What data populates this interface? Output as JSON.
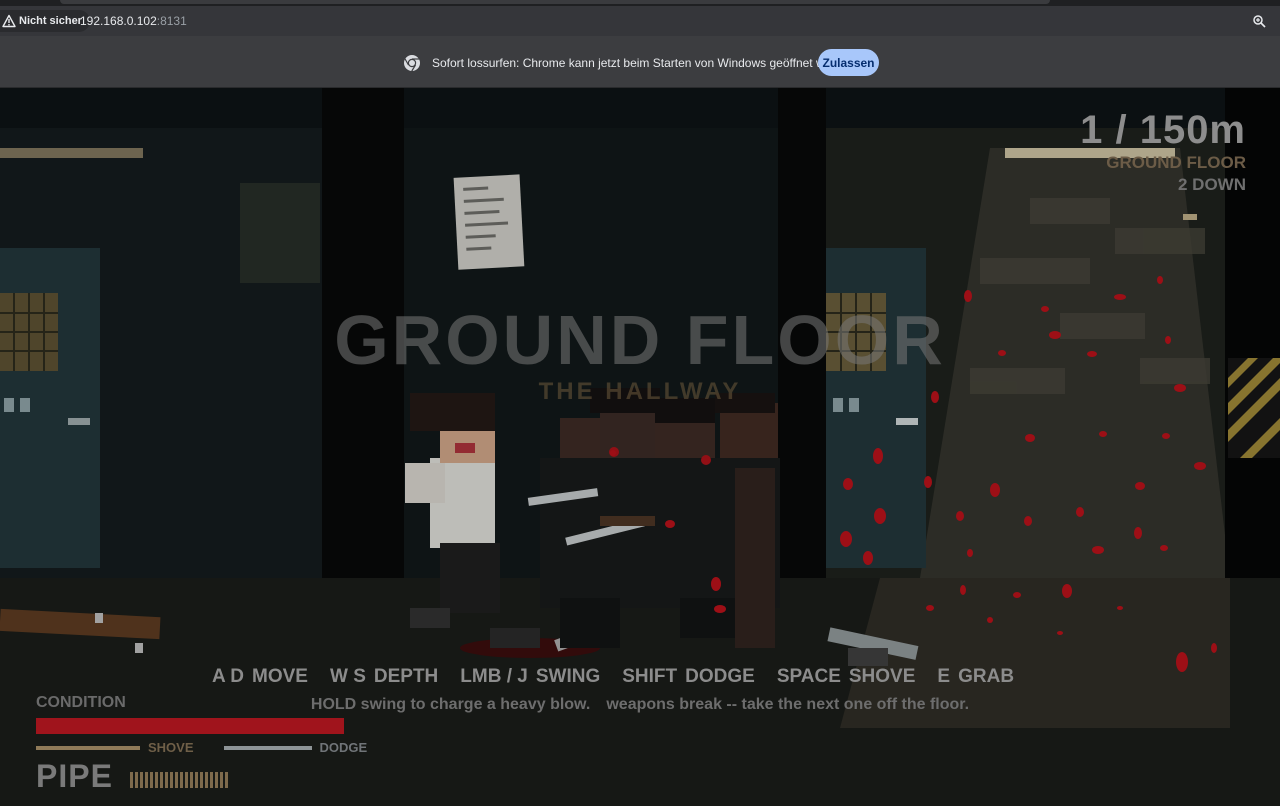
{
  "browser": {
    "security_label": "Nicht sicher",
    "url_host": "192.168.0.102",
    "url_port": ":8131",
    "icons": [
      "warning-icon",
      "zoom-icon",
      "chrome-logo-icon"
    ],
    "infobar": {
      "message": "Sofort lossurfen: Chrome kann jetzt beim Starten von Windows geöffnet werden.",
      "allow_label": "Zulassen"
    }
  },
  "hud": {
    "depth": "1 / 150m",
    "floor": "GROUND FLOOR",
    "floors_down": "2 DOWN",
    "level_title": "GROUND FLOOR",
    "level_subtitle": "THE HALLWAY",
    "controls": [
      {
        "key": "A D",
        "action": "MOVE"
      },
      {
        "key": "W S",
        "action": "DEPTH"
      },
      {
        "key": "LMB / J",
        "action": "SWING"
      },
      {
        "key": "SHIFT",
        "action": "DODGE"
      },
      {
        "key": "SPACE",
        "action": "SHOVE"
      },
      {
        "key": "E",
        "action": "GRAB"
      }
    ],
    "hint_1": "HOLD swing to charge a heavy blow.",
    "hint_2": "weapons break -- take the next one off the floor.",
    "condition_label": "CONDITION",
    "condition_fraction": 1.0,
    "shove_label": "SHOVE",
    "dodge_label": "DODGE",
    "weapon": "PIPE",
    "durability_ticks": 20,
    "colors": {
      "health": "#a0141c",
      "shove": "#8f7a58",
      "dodge": "#8e9497",
      "blood": "#b3121a"
    }
  }
}
